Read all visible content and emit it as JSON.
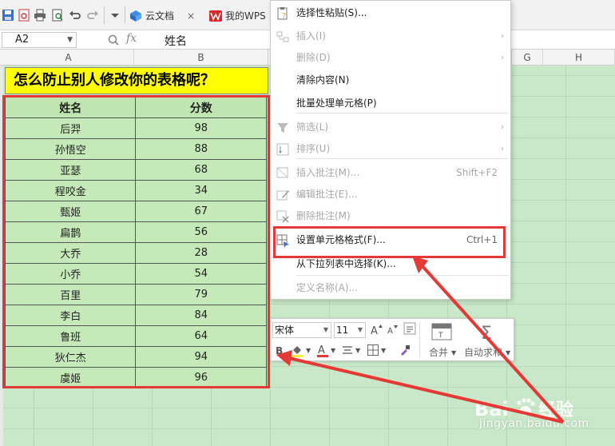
{
  "toolbar": {
    "tabs": [
      {
        "label": "云文档",
        "close": "×"
      },
      {
        "label": "我的WPS"
      }
    ]
  },
  "formula_bar": {
    "cell_ref": "A2",
    "fx": "fx",
    "value": "姓名"
  },
  "columns": [
    "A",
    "B",
    "G",
    "H"
  ],
  "sheet": {
    "title": "怎么防止别人修改你的表格呢？",
    "headers": [
      "姓名",
      "分数"
    ],
    "rows": [
      [
        "后羿",
        "98"
      ],
      [
        "孙悟空",
        "88"
      ],
      [
        "亚瑟",
        "68"
      ],
      [
        "程咬金",
        "34"
      ],
      [
        "甄姬",
        "67"
      ],
      [
        "扁鹊",
        "56"
      ],
      [
        "大乔",
        "28"
      ],
      [
        "小乔",
        "54"
      ],
      [
        "百里",
        "79"
      ],
      [
        "李白",
        "84"
      ],
      [
        "鲁班",
        "64"
      ],
      [
        "狄仁杰",
        "94"
      ],
      [
        "虞姬",
        "96"
      ]
    ]
  },
  "context_menu": {
    "items": [
      {
        "label": "选择性粘贴(S)...",
        "icon": "paste-special-icon",
        "disabled": false
      },
      {
        "label": "插入(I)",
        "icon": "insert-icon",
        "disabled": true,
        "submenu": true
      },
      {
        "label": "删除(D)",
        "icon": "",
        "disabled": true,
        "submenu": true
      },
      {
        "label": "清除内容(N)",
        "icon": "",
        "disabled": false
      },
      {
        "label": "批量处理单元格(P)",
        "icon": "",
        "disabled": false
      },
      {
        "label": "筛选(L)",
        "icon": "filter-icon",
        "disabled": true,
        "submenu": true
      },
      {
        "label": "排序(U)",
        "icon": "sort-icon",
        "disabled": true,
        "submenu": true
      },
      {
        "label": "插入批注(M)...",
        "icon": "insert-comment-icon",
        "disabled": true,
        "shortcut": "Shift+F2"
      },
      {
        "label": "编辑批注(E)...",
        "icon": "edit-comment-icon",
        "disabled": true
      },
      {
        "label": "删除批注(M)",
        "icon": "delete-comment-icon",
        "disabled": true
      },
      {
        "label": "设置单元格格式(F)...",
        "icon": "format-cells-icon",
        "disabled": false,
        "shortcut": "Ctrl+1"
      },
      {
        "label": "从下拉列表中选择(K)...",
        "icon": "",
        "disabled": false
      },
      {
        "label": "定义名称(A)...",
        "icon": "",
        "disabled": true
      }
    ]
  },
  "mini_toolbar": {
    "font": "宋体",
    "size": "11",
    "merge_label": "合并",
    "autosum_label": "自动求和"
  },
  "watermark": {
    "brand": "Bai",
    "brand2": "经验",
    "url": "jingyan.baidu.com"
  },
  "colors": {
    "accent_red": "#e53935",
    "grid_green": "#c9e8c9",
    "title_yellow": "#ffff00"
  }
}
